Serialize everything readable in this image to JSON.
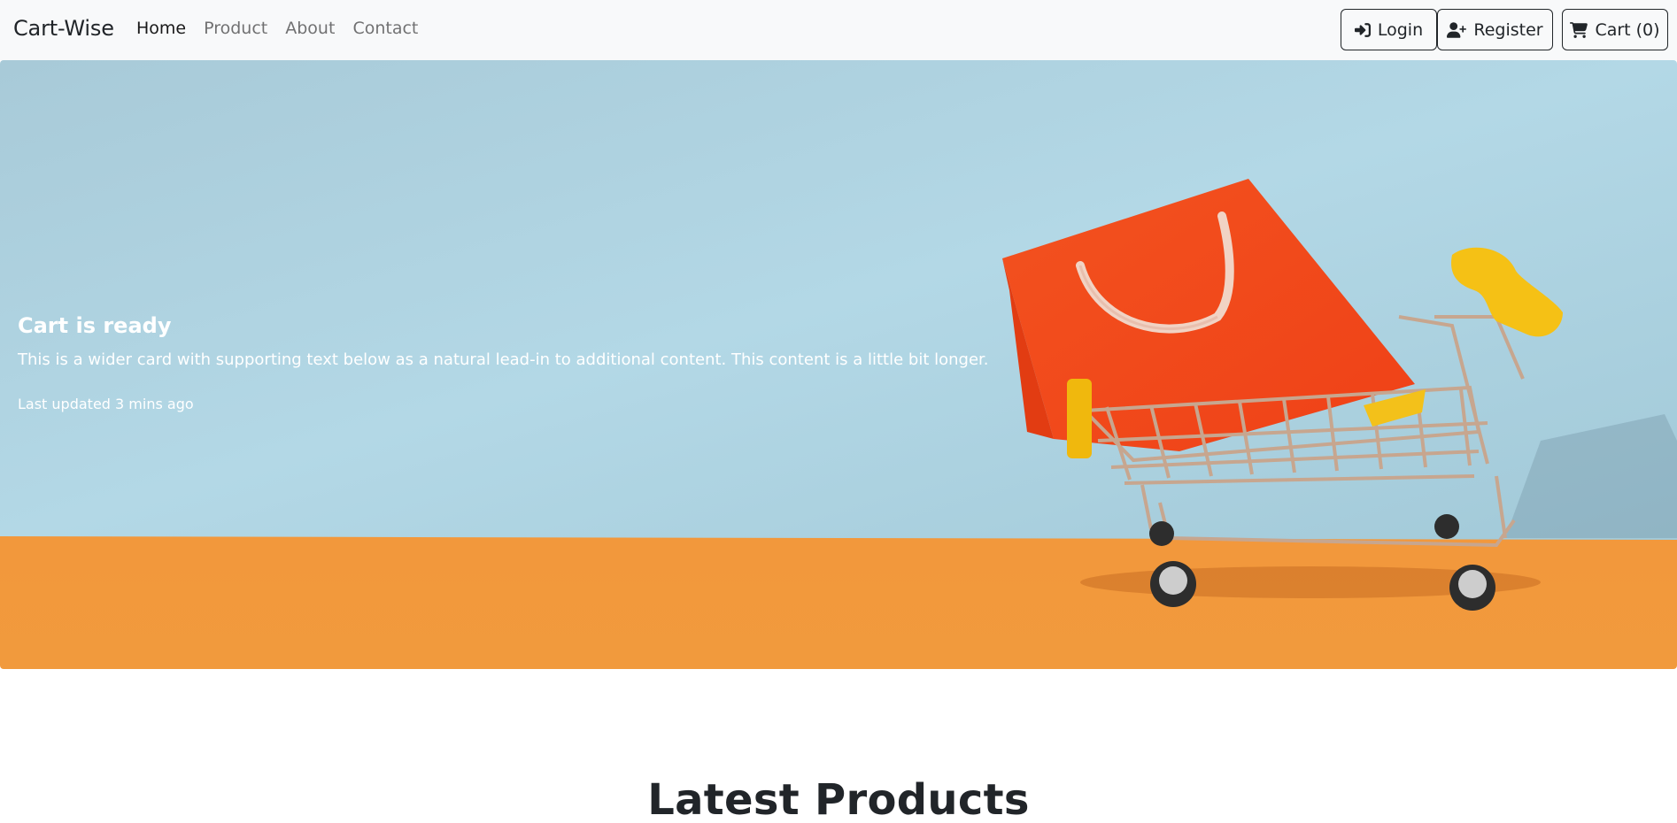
{
  "navbar": {
    "brand": "Cart-Wise",
    "links": [
      {
        "label": "Home",
        "active": true
      },
      {
        "label": "Product",
        "active": false
      },
      {
        "label": "About",
        "active": false
      },
      {
        "label": "Contact",
        "active": false
      }
    ],
    "buttons": {
      "login": {
        "label": "Login",
        "icon": "sign-in-icon"
      },
      "register": {
        "label": "Register",
        "icon": "user-plus-icon"
      },
      "cart": {
        "label": "Cart (0)",
        "icon": "shopping-cart-icon"
      }
    }
  },
  "hero": {
    "title": "Cart is ready",
    "text": "This is a wider card with supporting text below as a natural lead-in to additional content. This content is a little bit longer.",
    "updated": "Last updated 3 mins ago",
    "image": "shopping-cart-with-bag-photo"
  },
  "section": {
    "title": "Latest Products"
  },
  "colors": {
    "navbar_bg": "#f8f9fa",
    "hero_sky": "#a9d0de",
    "hero_floor": "#f09a3e",
    "bag_red": "#f24a1f",
    "handle_yellow": "#f6c21a",
    "text_dark": "#212529"
  }
}
